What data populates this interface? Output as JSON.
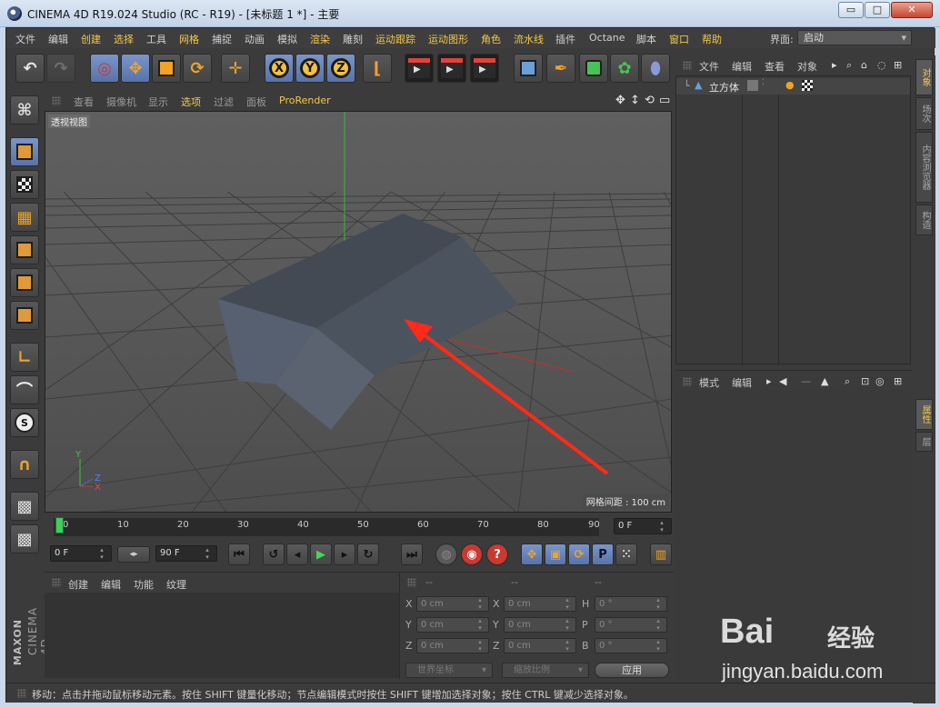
{
  "window": {
    "title": "CINEMA 4D R19.024 Studio (RC - R19) - [未标题 1 *] - 主要",
    "min_glyph": "▭",
    "max_glyph": "□",
    "close_glyph": "✕"
  },
  "menubar": {
    "items": [
      "文件",
      "编辑",
      "创建",
      "选择",
      "工具",
      "网格",
      "捕捉",
      "动画",
      "模拟",
      "渲染",
      "雕刻",
      "运动跟踪",
      "运动图形",
      "角色",
      "流水线",
      "插件",
      "Octane",
      "脚本",
      "窗口",
      "帮助"
    ],
    "highlight_color": "#f2c84a",
    "layout_label": "界面:",
    "layout_value": "启动"
  },
  "toolbar": {
    "axis_x": "X",
    "axis_y": "Y",
    "axis_z": "Z"
  },
  "viewport": {
    "menu": [
      "查看",
      "摄像机",
      "显示",
      "选项",
      "过滤",
      "面板",
      "ProRender"
    ],
    "label": "透视视图",
    "grid_spacing": "网格间距 : 100 cm",
    "axis_labels": {
      "x": "X",
      "y": "Y",
      "z": "Z"
    }
  },
  "timeline": {
    "ticks": [
      "0",
      "10",
      "20",
      "30",
      "40",
      "50",
      "60",
      "70",
      "80",
      "90"
    ],
    "current_frame": "0 F",
    "start": "0 F",
    "end": "90 F"
  },
  "materials": {
    "menu": [
      "创建",
      "编辑",
      "功能",
      "纹理"
    ]
  },
  "coords": {
    "header": [
      "--",
      "--",
      "--"
    ],
    "rows": [
      {
        "a": "X",
        "av": "0 cm",
        "b": "X",
        "bv": "0 cm",
        "c": "H",
        "cv": "0 °"
      },
      {
        "a": "Y",
        "av": "0 cm",
        "b": "Y",
        "bv": "0 cm",
        "c": "P",
        "cv": "0 °"
      },
      {
        "a": "Z",
        "av": "0 cm",
        "b": "Z",
        "bv": "0 cm",
        "c": "B",
        "cv": "0 °"
      }
    ],
    "world": "世界坐标",
    "scale": "缩放比例",
    "apply": "应用"
  },
  "objects": {
    "menu": [
      "文件",
      "编辑",
      "查看",
      "对象"
    ],
    "item": "立方体"
  },
  "attributes": {
    "menu": [
      "模式",
      "编辑"
    ]
  },
  "right_tabs": [
    "对象",
    "场次",
    "内容浏览器",
    "构造",
    "属性",
    "层"
  ],
  "status": "移动：点击并拖动鼠标移动元素。按住 SHIFT 键量化移动；节点编辑模式时按住 SHIFT 键增加选择对象；按住 CTRL 键减少选择对象。",
  "watermark": {
    "brand": "Bai",
    "cn": "经验",
    "url": "jingyan.baidu.com"
  }
}
